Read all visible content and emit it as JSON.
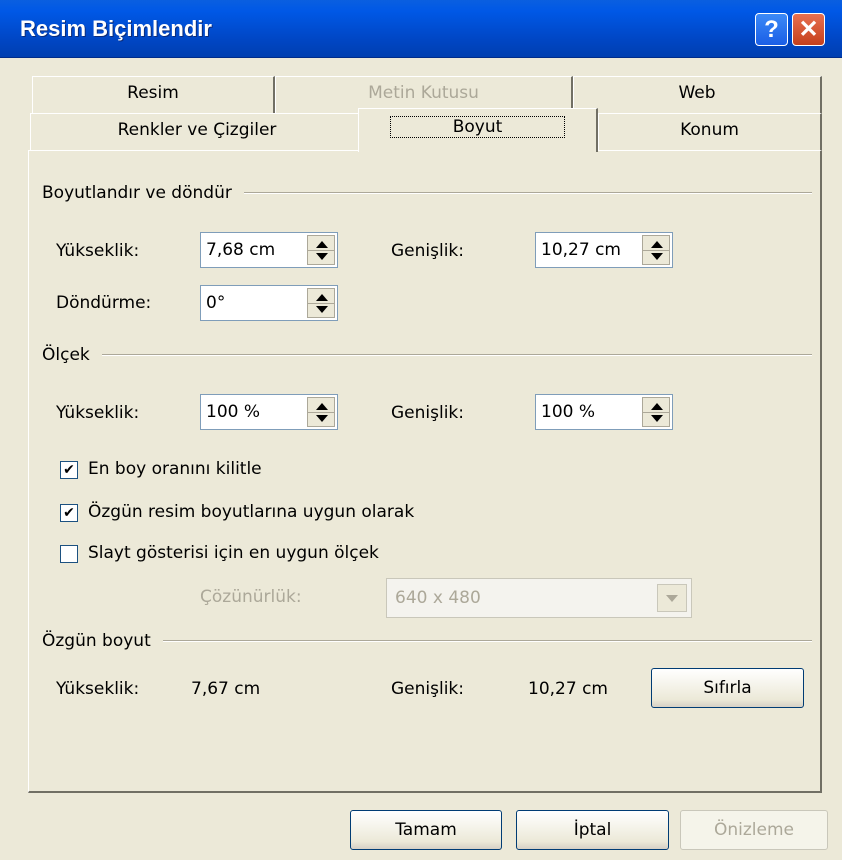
{
  "window": {
    "title": "Resim Biçimlendir",
    "help_label": "?",
    "close_label": "✕"
  },
  "tabs": {
    "row1": [
      {
        "label": "Resim",
        "disabled": false
      },
      {
        "label": "Metin Kutusu",
        "disabled": true
      },
      {
        "label": "Web",
        "disabled": false
      }
    ],
    "row2": [
      {
        "label": "Renkler ve Çizgiler"
      },
      {
        "label": "Boyut",
        "active": true
      },
      {
        "label": "Konum"
      }
    ]
  },
  "size_rotate": {
    "group_label": "Boyutlandır ve döndür",
    "height_label": "Yükseklik:",
    "height_value": "7,68 cm",
    "width_label": "Genişlik:",
    "width_value": "10,27 cm",
    "rotation_label": "Döndürme:",
    "rotation_value": "0°"
  },
  "scale": {
    "group_label": "Ölçek",
    "height_label": "Yükseklik:",
    "height_value": "100 %",
    "width_label": "Genişlik:",
    "width_value": "100 %",
    "lock_aspect_label": "En boy oranını kilitle",
    "lock_aspect_checked": true,
    "relative_label": "Özgün resim boyutlarına uygun olarak",
    "relative_checked": true,
    "slideshow_label": "Slayt gösterisi için en uygun ölçek",
    "slideshow_checked": false,
    "resolution_label": "Çözünürlük:",
    "resolution_value": "640 x 480"
  },
  "original_size": {
    "group_label": "Özgün boyut",
    "height_label": "Yükseklik:",
    "height_value": "7,67 cm",
    "width_label": "Genişlik:",
    "width_value": "10,27 cm",
    "reset_label": "Sıfırla"
  },
  "footer": {
    "ok_label": "Tamam",
    "cancel_label": "İptal",
    "preview_label": "Önizleme"
  }
}
